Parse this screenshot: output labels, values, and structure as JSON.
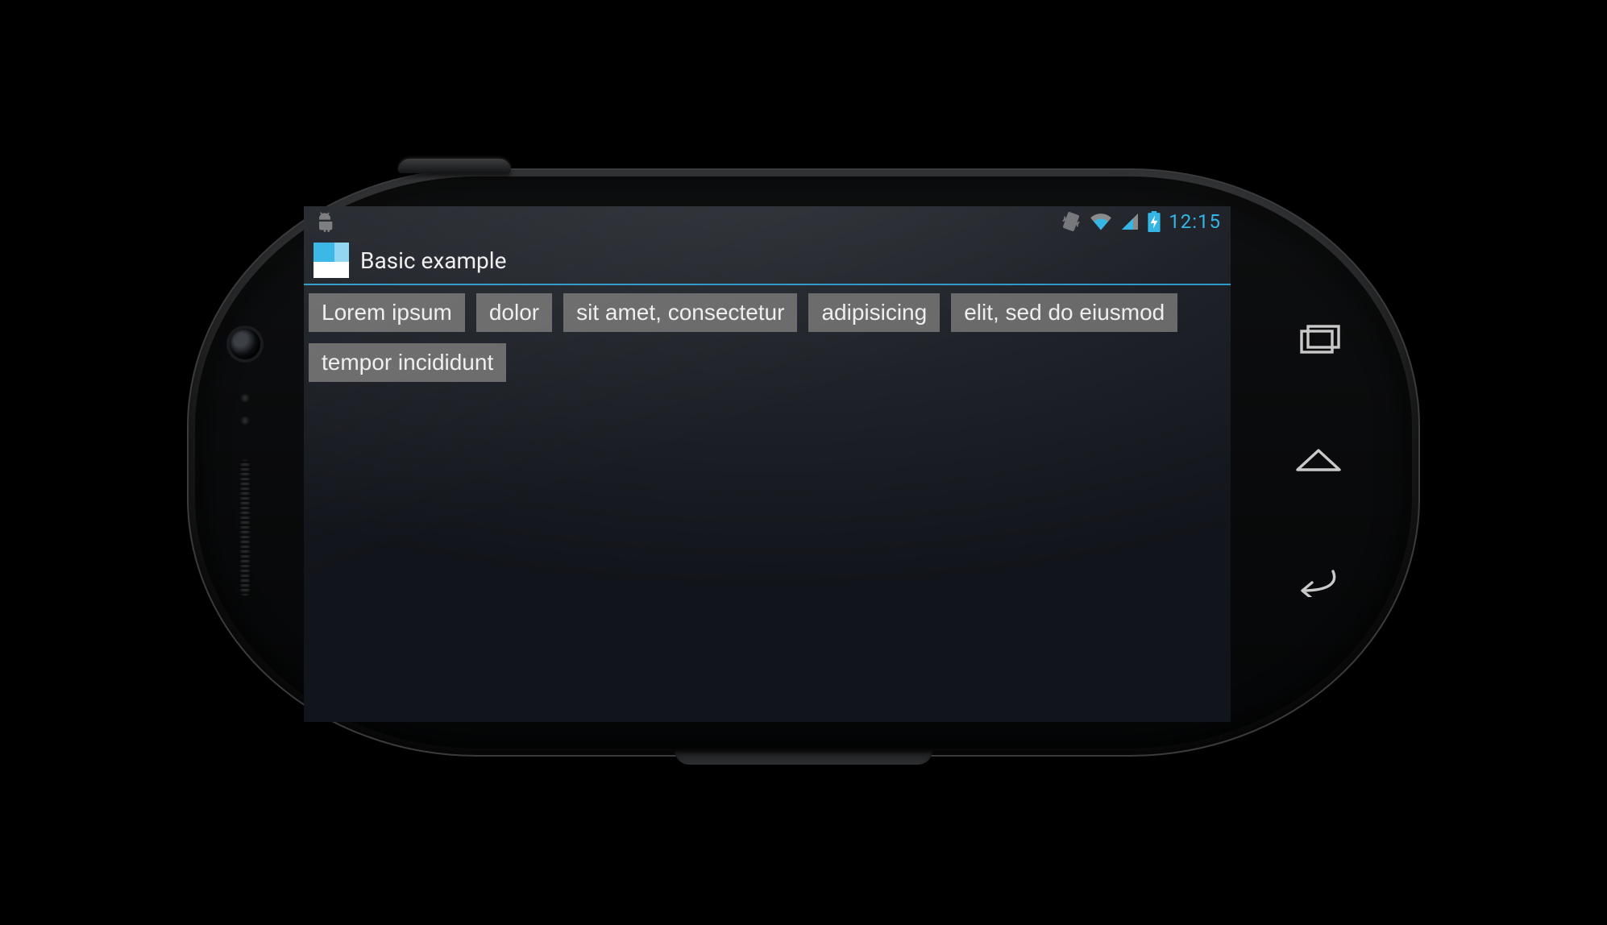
{
  "statusbar": {
    "time": "12:15"
  },
  "actionbar": {
    "title": "Basic example"
  },
  "chips": [
    "Lorem ipsum",
    "dolor",
    "sit amet, consectetur",
    "adipisicing",
    "elit, sed do eiusmod",
    "tempor incididunt"
  ]
}
